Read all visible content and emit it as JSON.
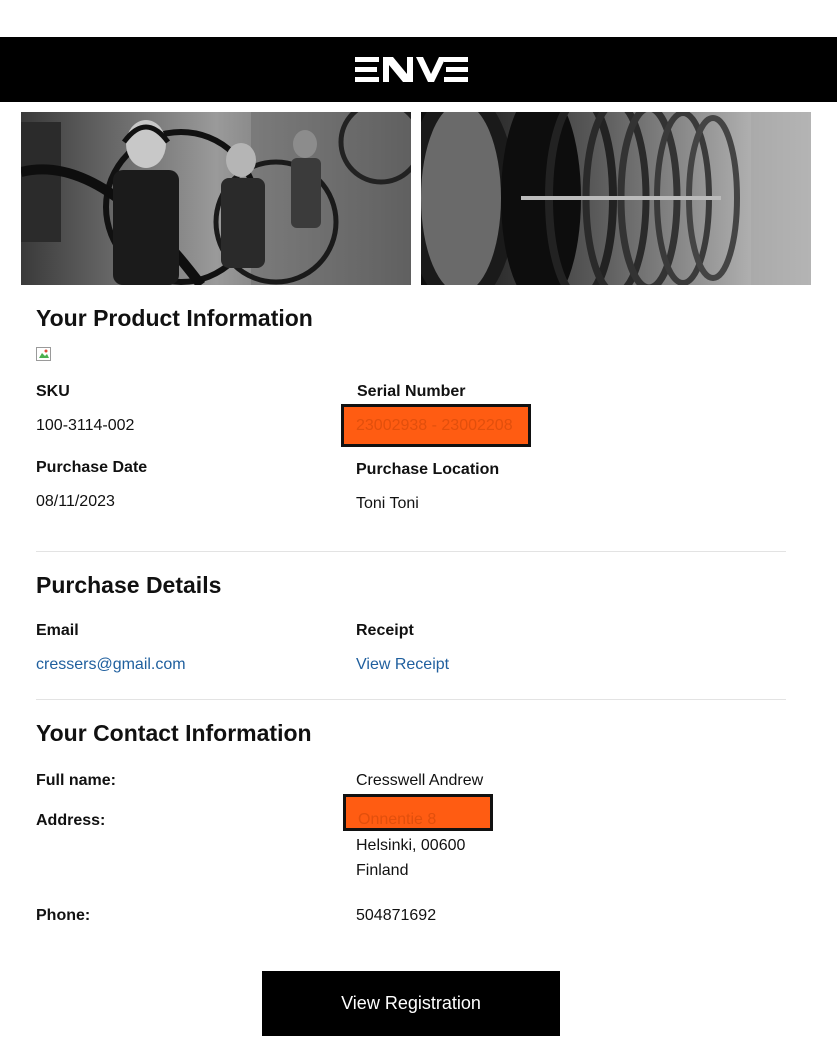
{
  "header": {
    "logo_alt": "ENVE"
  },
  "product": {
    "title": "Your Product Information",
    "sku_label": "SKU",
    "sku_value": "100-3114-002",
    "serial_label": "Serial Number",
    "serial_value": "23002938 - 23002208",
    "purchase_date_label": "Purchase Date",
    "purchase_date_value": "08/11/2023",
    "purchase_location_label": "Purchase Location",
    "purchase_location_value": "Toni Toni"
  },
  "purchase": {
    "title": "Purchase Details",
    "email_label": "Email",
    "email_value": "cressers@gmail.com",
    "receipt_label": "Receipt",
    "receipt_link": "View Receipt"
  },
  "contact": {
    "title": "Your Contact Information",
    "fullname_label": "Full name:",
    "fullname_value": "Cresswell Andrew",
    "address_label": "Address:",
    "address_line1": "Onnentie 8",
    "address_line2": "Helsinki, 00600",
    "address_line3": "Finland",
    "phone_label": "Phone:",
    "phone_value": "504871692"
  },
  "cta": {
    "label": "View Registration"
  },
  "colors": {
    "header": "#000000",
    "link": "#1f5f9e",
    "redaction": "#ff5c12",
    "button": "#000000"
  }
}
